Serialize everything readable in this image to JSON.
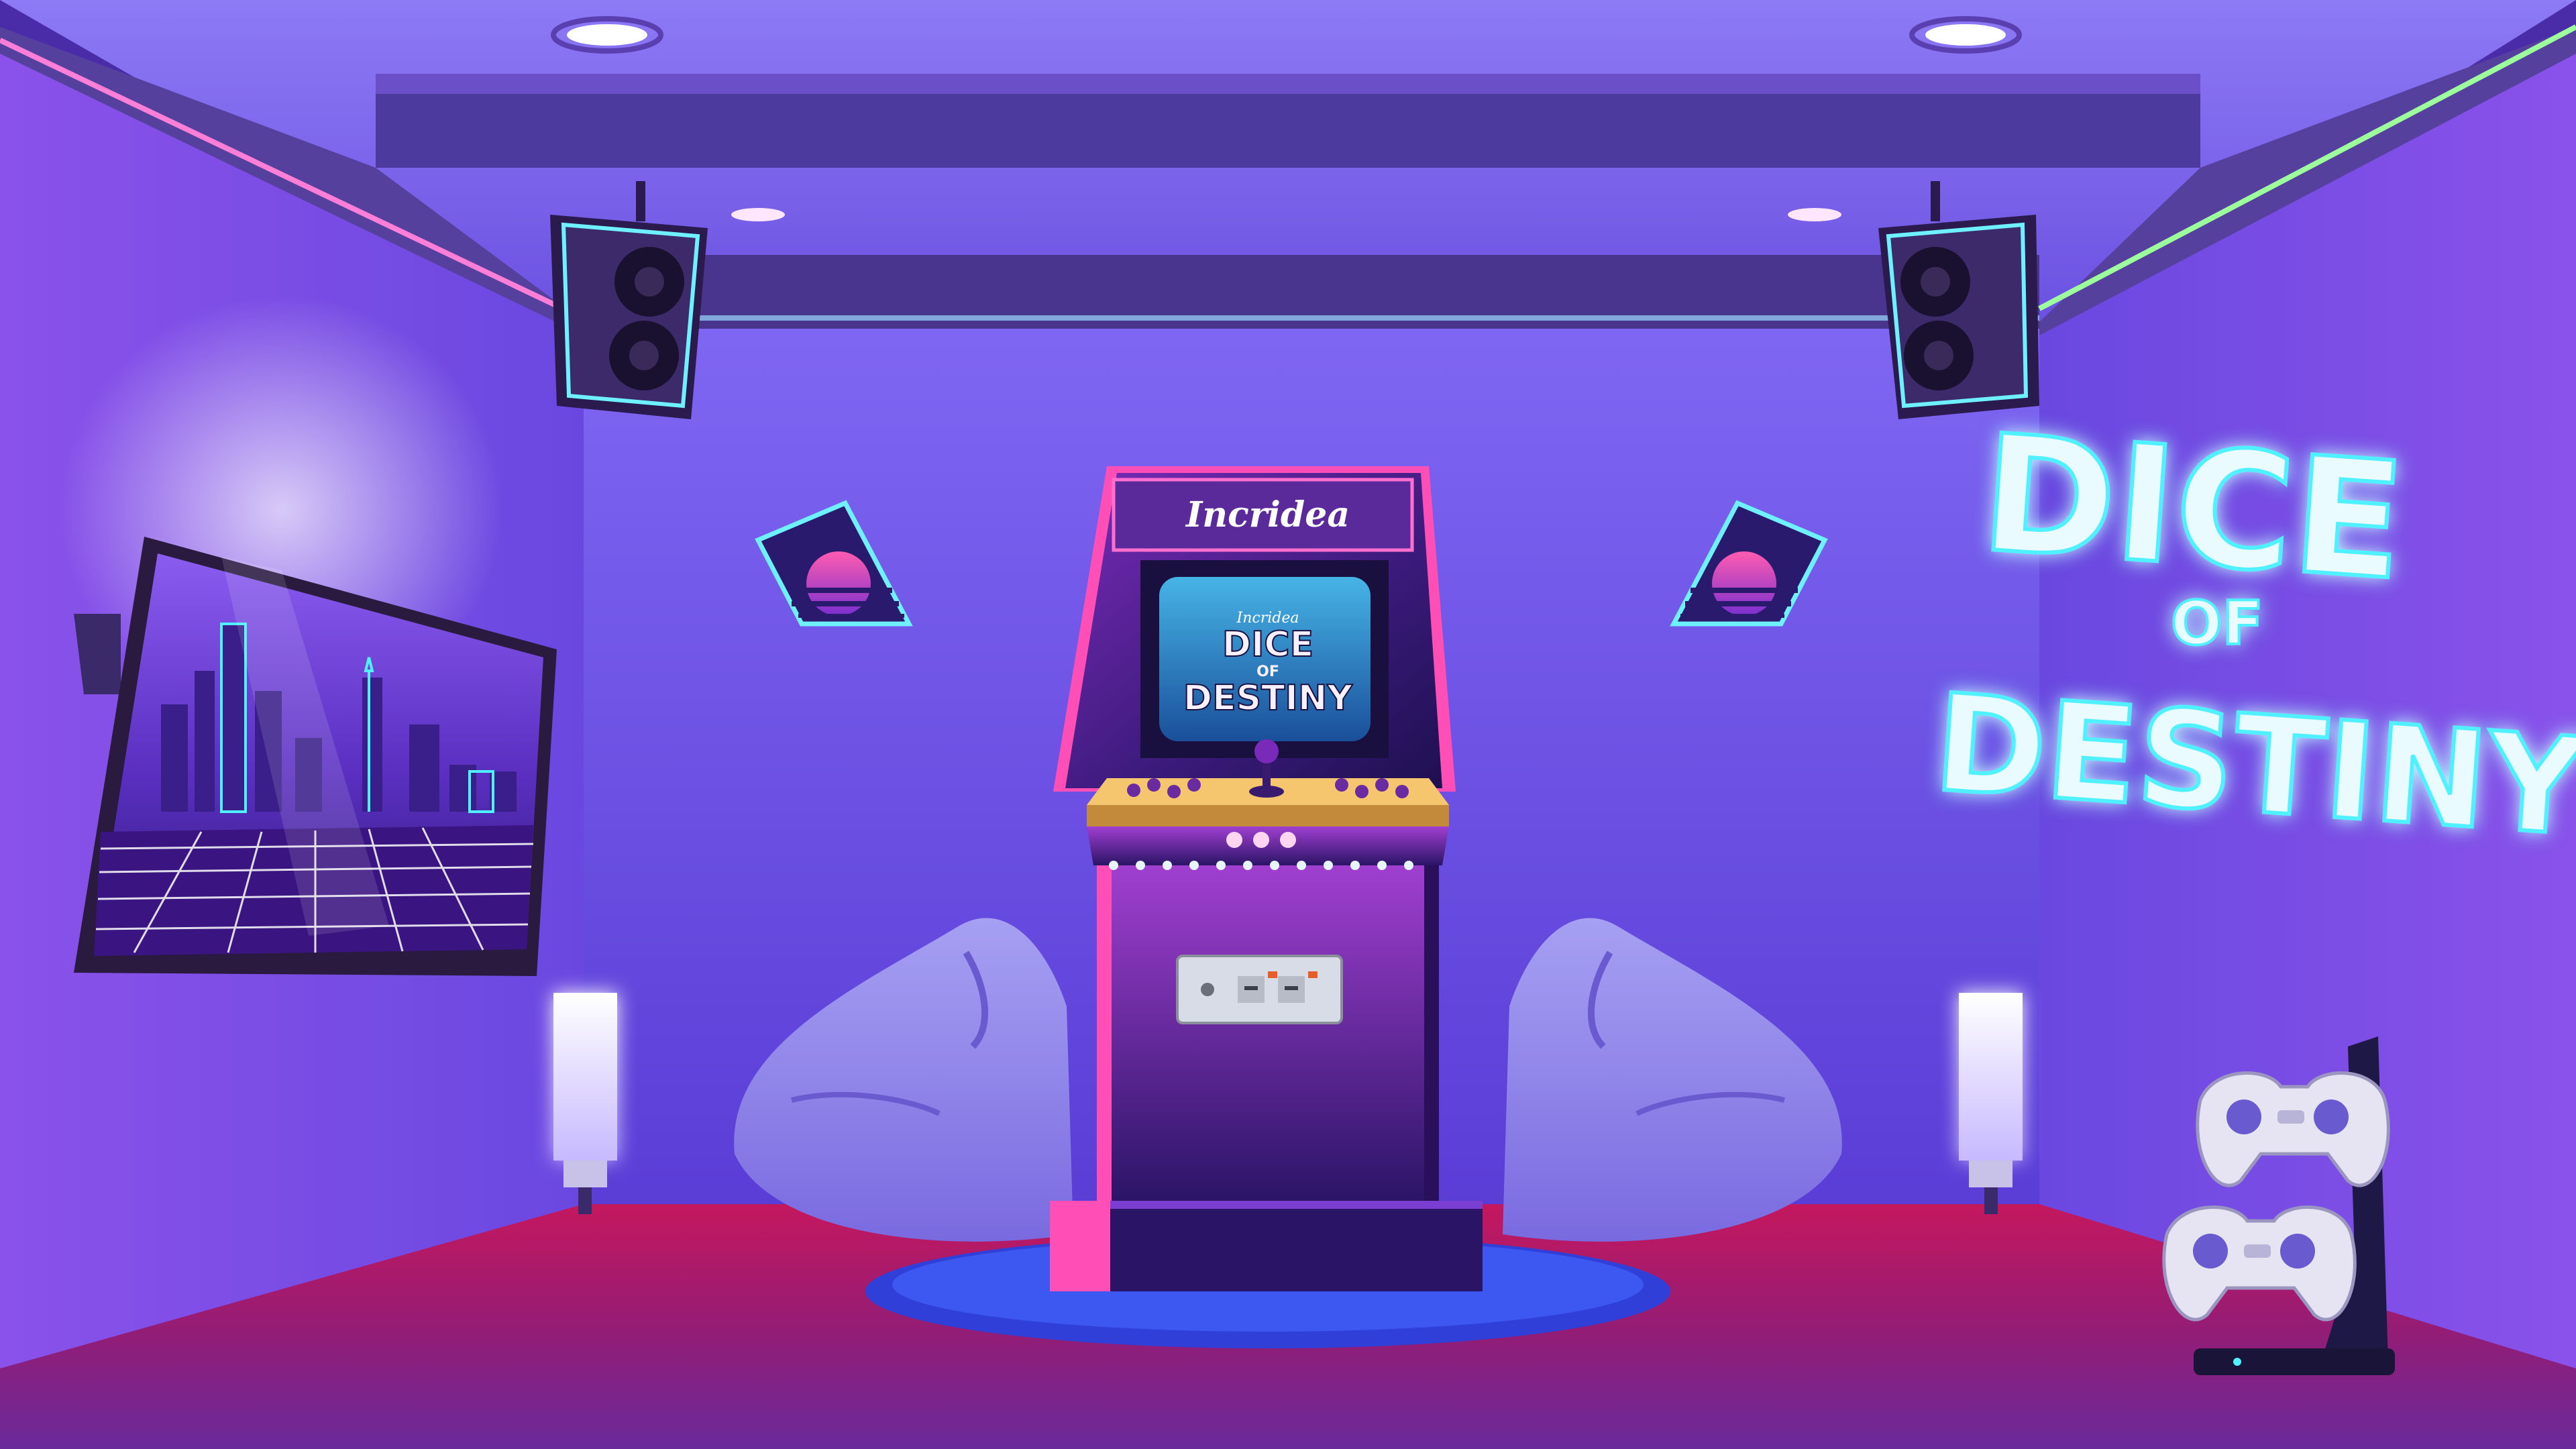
{
  "scene": {
    "title_sign": {
      "line1": "DICE",
      "line2": "OF",
      "line3": "DESTINY",
      "glow_color": "#7ff3ff"
    },
    "arcade": {
      "marquee": "Incridea",
      "screen_brand": "Incridea",
      "screen_line1": "DICE",
      "screen_line2": "OF",
      "screen_line3": "DESTINY"
    },
    "colors": {
      "wall": "#6a4fe0",
      "ceiling": "#7a5bf0",
      "floor": "#8a1f7a",
      "neon_cyan": "#4ff0ff",
      "neon_pink": "#ff4fb6",
      "cabinet": "#3a1a6e"
    },
    "icons": [
      "speaker-icon",
      "tv-icon",
      "controller-icon",
      "bean-bag-icon",
      "floor-lamp-icon"
    ]
  }
}
